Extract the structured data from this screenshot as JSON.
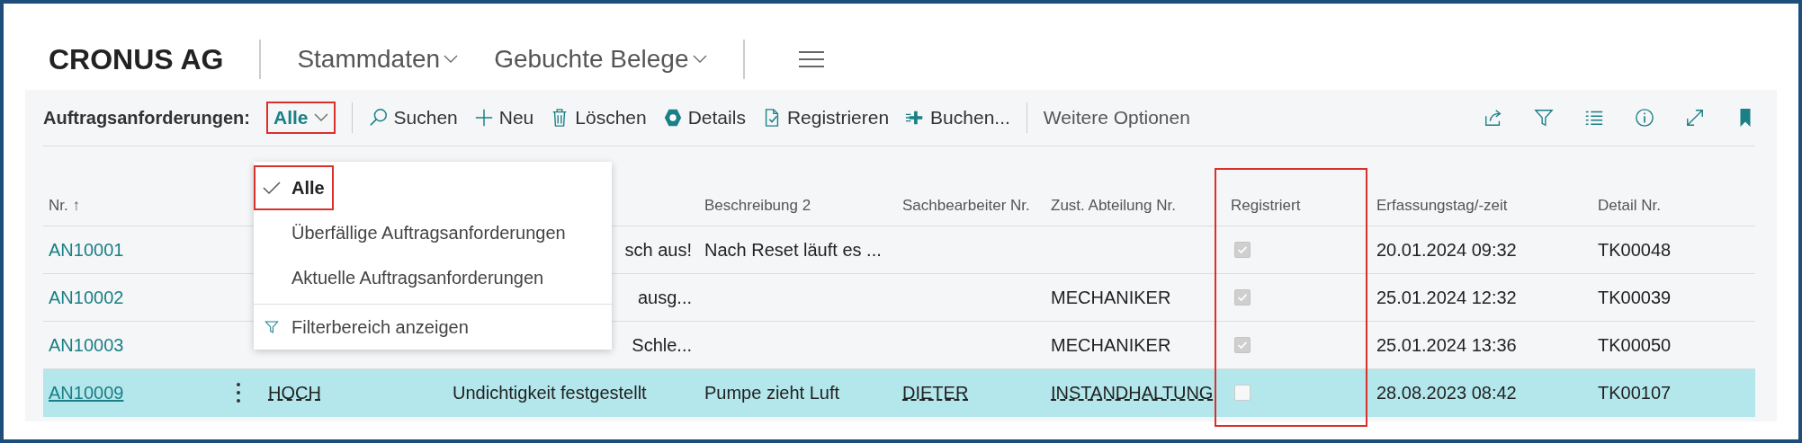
{
  "app": {
    "title": "CRONUS AG",
    "nav": [
      {
        "label": "Stammdaten"
      },
      {
        "label": "Gebuchte Belege"
      }
    ]
  },
  "toolbar": {
    "label": "Auftragsanforderungen:",
    "view": {
      "label": "Alle",
      "highlighted": true
    },
    "actions": [
      {
        "kind": "search",
        "label": "Suchen"
      },
      {
        "kind": "new",
        "label": "Neu"
      },
      {
        "kind": "delete",
        "label": "Löschen"
      },
      {
        "kind": "details",
        "label": "Details"
      },
      {
        "kind": "register",
        "label": "Registrieren"
      },
      {
        "kind": "post",
        "label": "Buchen..."
      }
    ],
    "more": "Weitere Optionen"
  },
  "filter_menu": {
    "open": true,
    "items": [
      {
        "label": "Alle",
        "selected": true,
        "highlighted": true
      },
      {
        "label": "Überfällige Auftragsanforderungen",
        "selected": false,
        "highlighted": false
      },
      {
        "label": "Aktuelle Auftragsanforderungen",
        "selected": false,
        "highlighted": false
      }
    ],
    "footer": "Filterbereich anzeigen"
  },
  "table": {
    "columns": [
      {
        "label": "Nr. ↑",
        "highlighted": false
      },
      {
        "label": "Beschreibung 2",
        "highlighted": false
      },
      {
        "label": "Sachbearbeiter Nr.",
        "highlighted": false
      },
      {
        "label": "Zust. Abteilung Nr.",
        "highlighted": false
      },
      {
        "label": "Registriert",
        "highlighted": true
      },
      {
        "label": "Erfassungstag/-zeit",
        "highlighted": false
      },
      {
        "label": "Detail Nr.",
        "highlighted": false
      }
    ],
    "rows": [
      {
        "selected": false,
        "nr": "AN10001",
        "column_3": "sch aus!",
        "beschreibung_2": "Nach Reset läuft es ...",
        "registriert": true,
        "erfassung": "20.01.2024 09:32",
        "detail": "TK00048"
      },
      {
        "selected": false,
        "nr": "AN10002",
        "column_3": "ausg...",
        "registriert": true,
        "abteilung": "MECHANIKER",
        "erfassung": "25.01.2024 12:32",
        "detail": "TK00039"
      },
      {
        "selected": false,
        "nr": "AN10003",
        "column_3": "Schle...",
        "registriert": true,
        "abteilung": "MECHANIKER",
        "erfassung": "25.01.2024 13:36",
        "detail": "TK00050"
      },
      {
        "selected": true,
        "nr": "AN10009",
        "column_2": "HOCH",
        "column_3": "Undichtigkeit festgestellt",
        "beschreibung_2": "Pumpe zieht Luft",
        "sachbearbeiter": "DIETER",
        "abteilung": "INSTANDHALTUNG",
        "registriert": false,
        "erfassung": "28.08.2023 08:42",
        "detail": "TK00107"
      }
    ]
  }
}
